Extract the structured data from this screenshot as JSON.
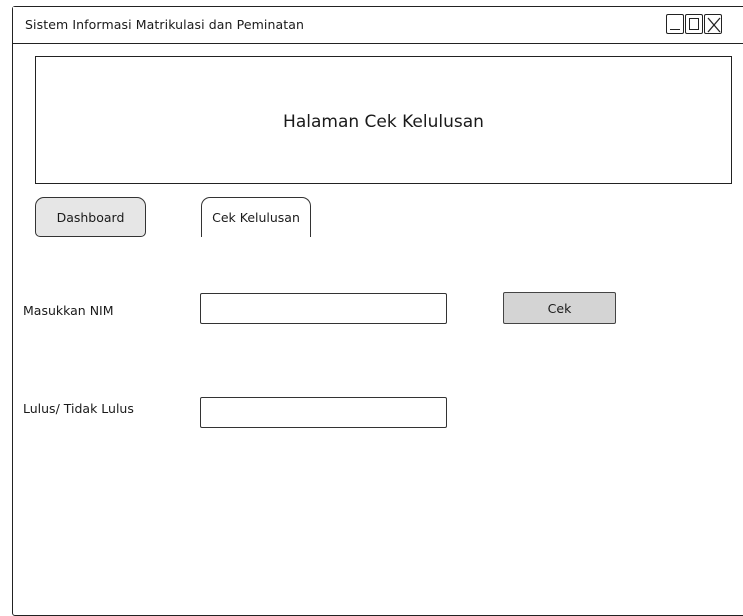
{
  "window": {
    "title": "Sistem Informasi Matrikulasi dan Peminatan",
    "controls": {
      "minimize_icon": "minimize-icon",
      "maximize_icon": "maximize-icon",
      "close_icon": "close-icon"
    }
  },
  "header": {
    "title": "Halaman Cek Kelulusan"
  },
  "nav": {
    "items": [
      {
        "label": "Dashboard"
      },
      {
        "label": "Cek Kelulusan"
      }
    ]
  },
  "form": {
    "nim_label": "Masukkan NIM",
    "nim_value": "",
    "check_button_label": "Cek",
    "result_label": "Lulus/ Tidak Lulus",
    "result_value": ""
  },
  "colors": {
    "button_fill": "#e6e6e6",
    "check_button_fill": "#d4d4d4",
    "border": "#222222"
  }
}
